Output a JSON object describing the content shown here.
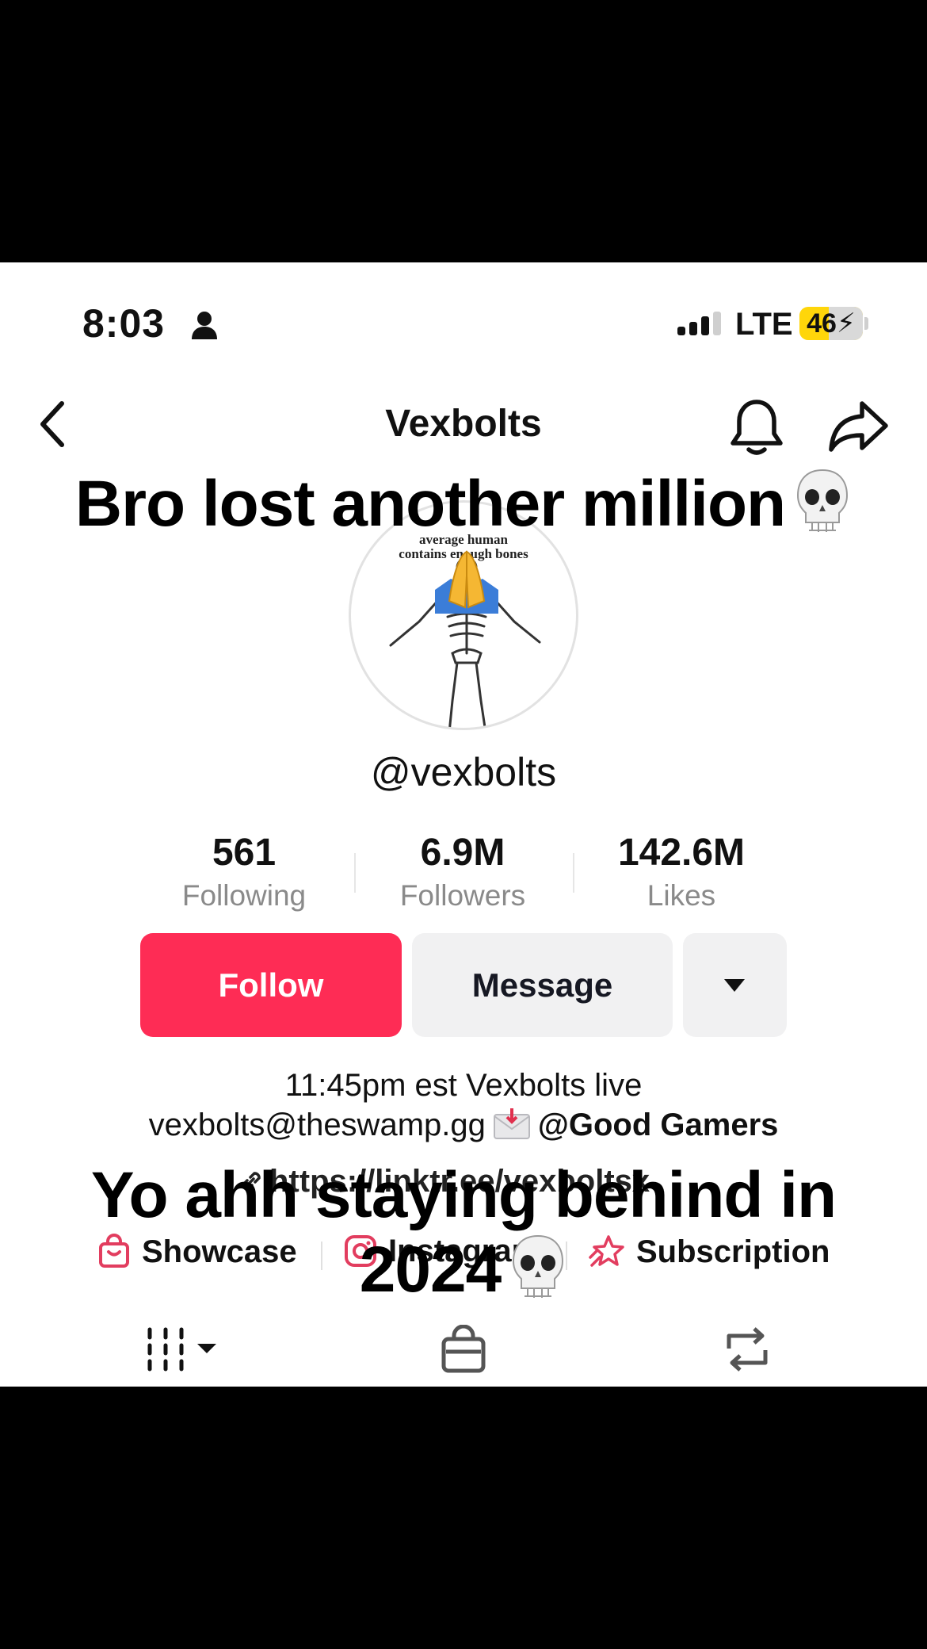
{
  "status_bar": {
    "time": "8:03",
    "carrier": "LTE",
    "battery": "46",
    "battery_level": 0.46
  },
  "header": {
    "title": "Vexbolts",
    "icons": [
      "chevron-left-icon",
      "bell-icon",
      "share-icon"
    ]
  },
  "avatar": {
    "caption_line1": "average human",
    "caption_line2": "contains enough bones"
  },
  "profile": {
    "username": "@vexbolts"
  },
  "stats": [
    {
      "value": "561",
      "label": "Following"
    },
    {
      "value": "6.9M",
      "label": "Followers"
    },
    {
      "value": "142.6M",
      "label": "Likes"
    }
  ],
  "actions": {
    "follow": "Follow",
    "message": "Message"
  },
  "bio": {
    "line1": "11:45pm est Vexbolts live",
    "email": "vexbolts@theswamp.gg",
    "mention": "@Good Gamers",
    "link": "https://linktr.ee/vexboltsx"
  },
  "profile_tabs": [
    {
      "label": "Showcase",
      "icon": "shopping-bag-icon"
    },
    {
      "label": "Instagram",
      "icon": "instagram-icon"
    },
    {
      "label": "Subscription",
      "icon": "subscription-star-icon"
    }
  ],
  "toolbar": {
    "icons": [
      "grid-icon",
      "shop-bag-icon",
      "repost-icon"
    ]
  },
  "overlay": {
    "top_caption": "Bro lost another million",
    "bottom_caption_line1": "Yo ahh staying behind in",
    "bottom_caption_line2": "2024"
  },
  "colors": {
    "follow": "#fe2c55",
    "secondary_button": "#f1f1f2",
    "muted_text": "#8a8a8a",
    "battery": "#ffd60a",
    "tab_icon": "#e23d5f"
  }
}
